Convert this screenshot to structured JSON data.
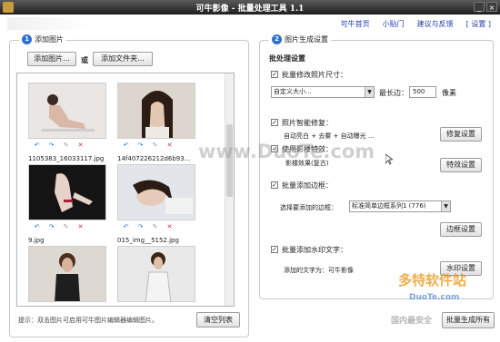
{
  "window": {
    "title": "可牛影像 - 批量处理工具 1.1"
  },
  "toplinks": [
    "可牛首页",
    "小贴门",
    "建议与反馈",
    "[ 设置 ]"
  ],
  "left": {
    "section_num": "1",
    "section_title": "添加图片",
    "add_pictures": "添加图片...",
    "or": "或",
    "add_folder": "添加文件夹...",
    "thumbnails": [
      {
        "name": "1105383_16033117.jpg",
        "icon": "woman-sitting-photo"
      },
      {
        "name": "14f407226212d6b93...",
        "icon": "woman-portrait-photo"
      },
      {
        "name": "9.jpg",
        "icon": "hand-dark-photo"
      },
      {
        "name": "015_img__5152.jpg",
        "icon": "woman-lying-photo"
      },
      {
        "name": "",
        "icon": "woman-standing-photo"
      },
      {
        "name": "",
        "icon": "woman-posing-photo"
      }
    ],
    "hint": "提示：双击图片可启用可牛图片编辑器编辑图片。",
    "clear_list": "清空列表"
  },
  "right": {
    "section_num": "2",
    "section_title": "图片生成设置",
    "heading": "批处理设置",
    "resize": {
      "label": "批量修改照片尺寸：",
      "checked": true,
      "select": "自定义大小...",
      "long_edge_label": "最长边：",
      "long_edge_value": "500",
      "unit": "像素"
    },
    "smart": {
      "label": "照片智能修复：",
      "checked": true,
      "desc": "自动亮白 + 去雾 + 自动曝光 ...",
      "button": "修复设置"
    },
    "effects": {
      "label": "使用影楼特效：",
      "checked": true,
      "desc": "影楼效果(复古)",
      "button": "特效设置"
    },
    "frame": {
      "label": "批量添加边框：",
      "checked": true,
      "choose_label": "选择要添加的边框：",
      "select": "标准简单边框系列1 (776)",
      "button": "边框设置"
    },
    "watermark": {
      "label": "批量添加水印文字：",
      "checked": true,
      "text_label": "添加的文字为：可牛影像",
      "button": "水印设置"
    },
    "generate": "批量生成所有"
  },
  "watermarks": {
    "duote_center": "www.DuoTe.com",
    "duote_logo": "多特软件站",
    "duote_url": "DuoTe.com",
    "footer_text": "国内最安全"
  }
}
